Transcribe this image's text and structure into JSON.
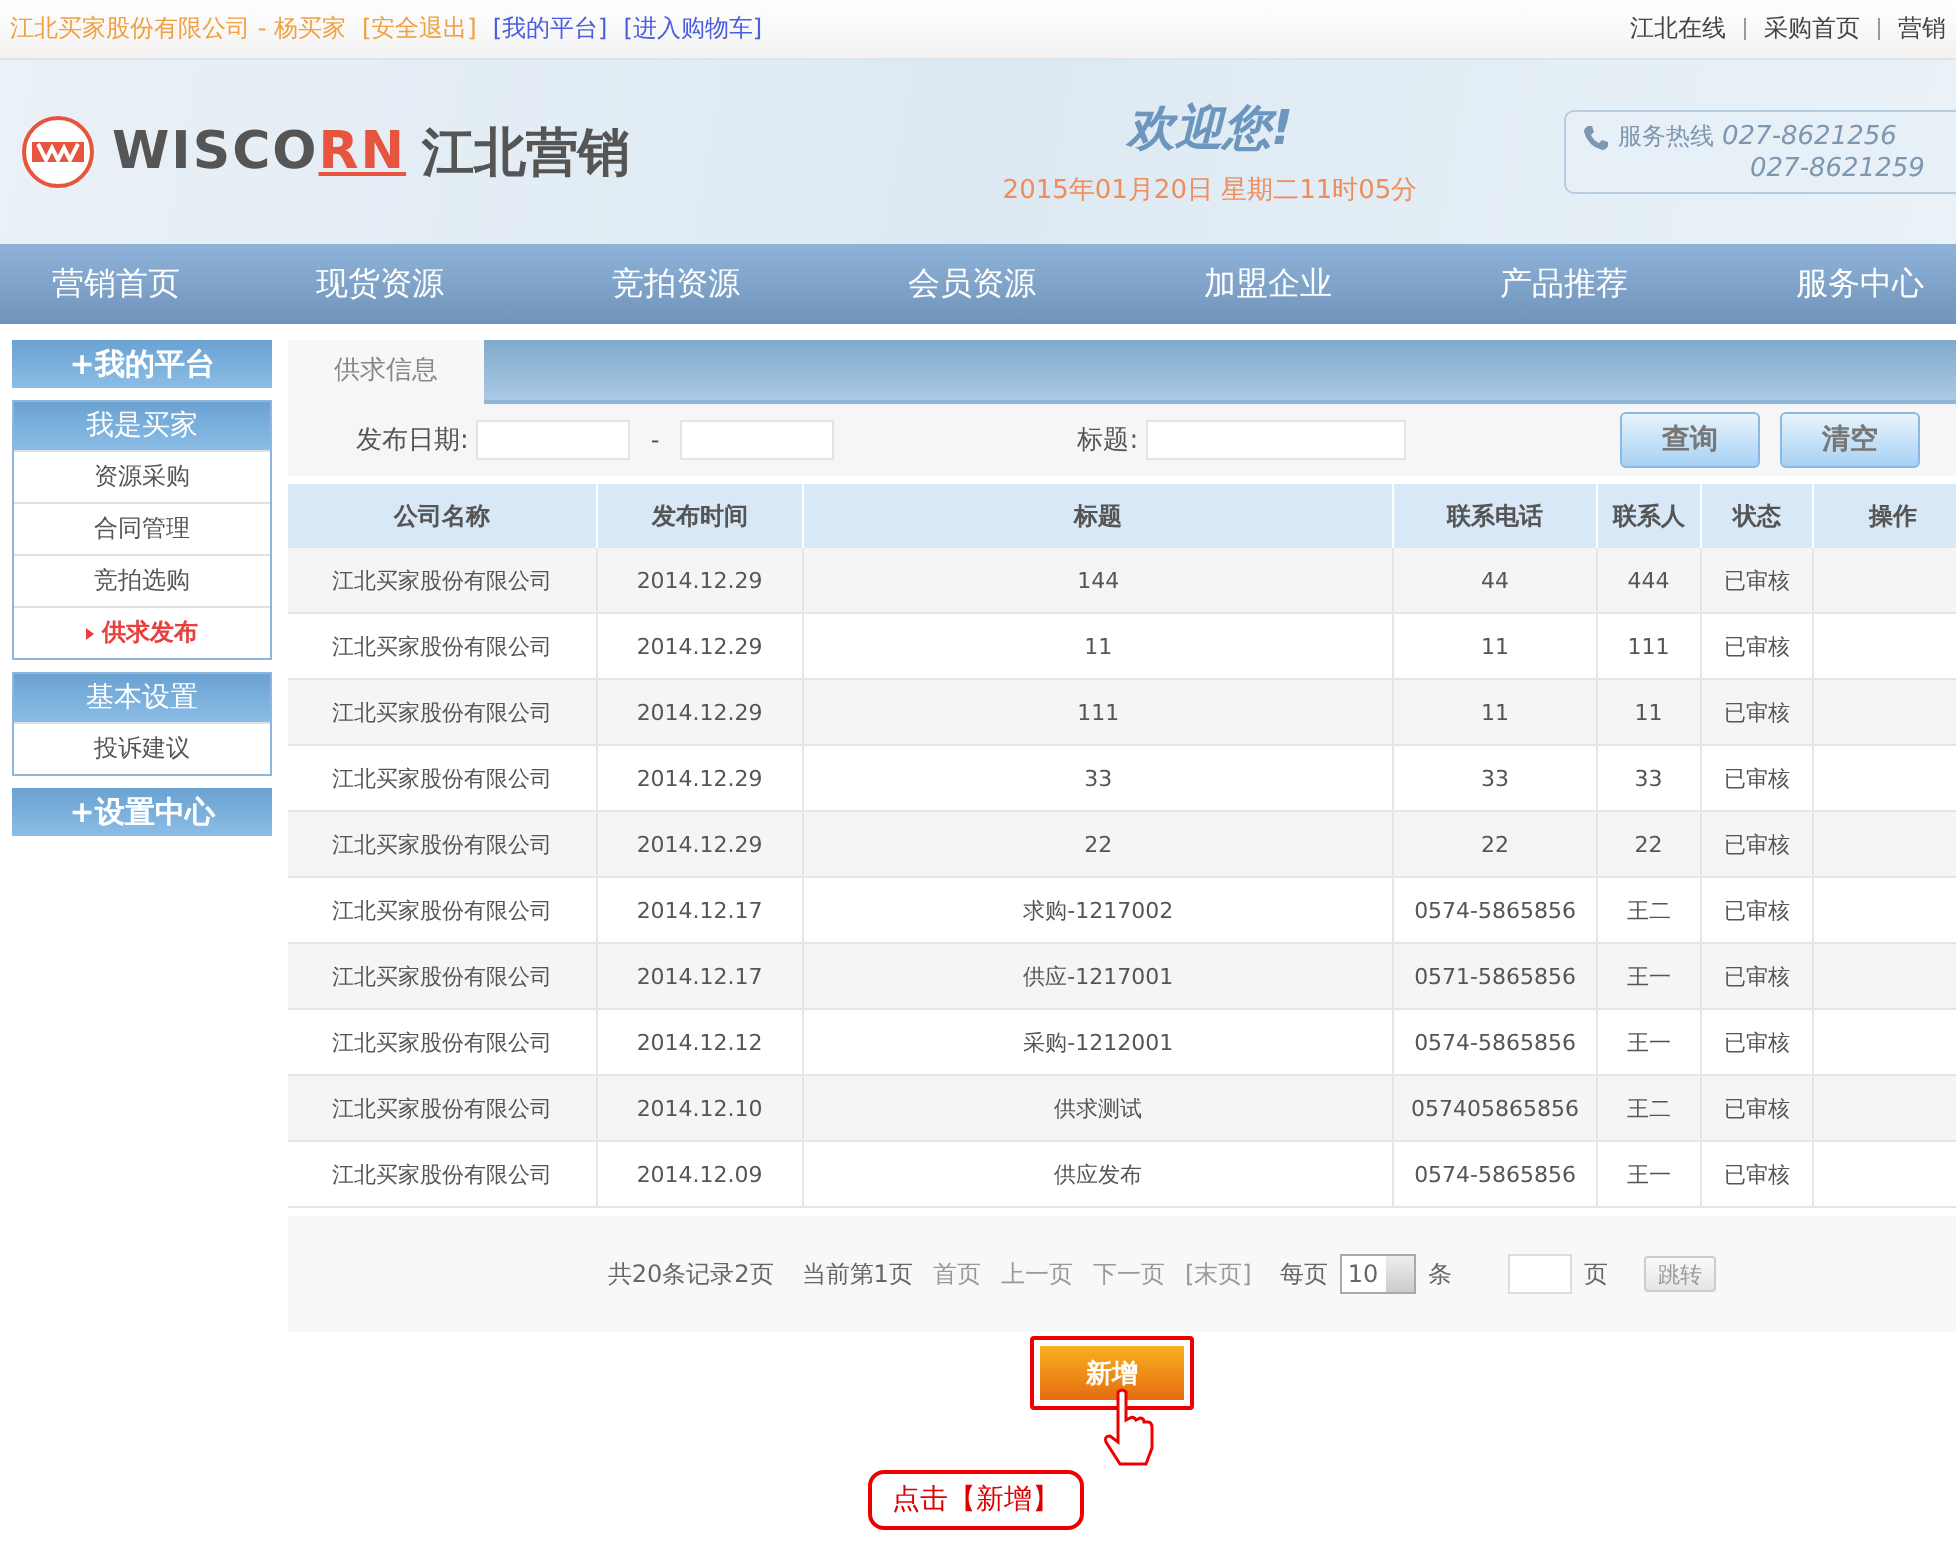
{
  "top_bar": {
    "user": "江北买家股份有限公司 - 杨买家",
    "links": [
      "[安全退出]",
      "[我的平台]",
      "[进入购物车]"
    ],
    "right_links": [
      "江北在线",
      "采购首页",
      "营销"
    ]
  },
  "header": {
    "logo": {
      "main": "WISCO",
      "accent": "RN",
      "cn": "江北营销"
    },
    "welcome": "欢迎您!",
    "datetime": "2015年01月20日 星期二11时05分",
    "hotline": {
      "label": "服务热线",
      "numbers": [
        "027-8621256",
        "027-8621259"
      ]
    }
  },
  "nav": [
    "营销首页",
    "现货资源",
    "竞拍资源",
    "会员资源",
    "加盟企业",
    "产品推荐",
    "服务中心"
  ],
  "sidebar": [
    {
      "kind": "title",
      "label": "+我的平台"
    },
    {
      "kind": "group",
      "label": "我是买家",
      "items": [
        {
          "label": "资源采购",
          "selected": false
        },
        {
          "label": "合同管理",
          "selected": false
        },
        {
          "label": "竞拍选购",
          "selected": false
        },
        {
          "label": "供求发布",
          "selected": true
        }
      ]
    },
    {
      "kind": "group",
      "label": "基本设置",
      "items": [
        {
          "label": "投诉建议",
          "selected": false
        }
      ]
    },
    {
      "kind": "title",
      "label": "+设置中心"
    }
  ],
  "tab": "供求信息",
  "filters": {
    "date_label": "发布日期:",
    "dash": "-",
    "title_label": "标题:",
    "buttons": [
      "查询",
      "清空"
    ]
  },
  "table": {
    "columns": [
      "公司名称",
      "发布时间",
      "标题",
      "联系电话",
      "联系人",
      "状态",
      "操作"
    ],
    "rows": [
      [
        "江北买家股份有限公司",
        "2014.12.29",
        "144",
        "44",
        "444",
        "已审核"
      ],
      [
        "江北买家股份有限公司",
        "2014.12.29",
        "11",
        "11",
        "111",
        "已审核"
      ],
      [
        "江北买家股份有限公司",
        "2014.12.29",
        "111",
        "11",
        "11",
        "已审核"
      ],
      [
        "江北买家股份有限公司",
        "2014.12.29",
        "33",
        "33",
        "33",
        "已审核"
      ],
      [
        "江北买家股份有限公司",
        "2014.12.29",
        "22",
        "22",
        "22",
        "已审核"
      ],
      [
        "江北买家股份有限公司",
        "2014.12.17",
        "求购-1217002",
        "0574-5865856",
        "王二",
        "已审核"
      ],
      [
        "江北买家股份有限公司",
        "2014.12.17",
        "供应-1217001",
        "0571-5865856",
        "王一",
        "已审核"
      ],
      [
        "江北买家股份有限公司",
        "2014.12.12",
        "采购-1212001",
        "0574-5865856",
        "王一",
        "已审核"
      ],
      [
        "江北买家股份有限公司",
        "2014.12.10",
        "供求测试",
        "057405865856",
        "王二",
        "已审核"
      ],
      [
        "江北买家股份有限公司",
        "2014.12.09",
        "供应发布",
        "0574-5865856",
        "王一",
        "已审核"
      ]
    ]
  },
  "pager": {
    "summary": "共20条记录2页",
    "current": "当前第1页",
    "links": [
      "首页",
      "上一页",
      "下一页",
      "[末页]"
    ],
    "per_page_label": "每页",
    "per_page": "10",
    "unit": "条",
    "page_label": "页",
    "jump": "跳转"
  },
  "add_button": "新增",
  "callout": "点击【新增】"
}
